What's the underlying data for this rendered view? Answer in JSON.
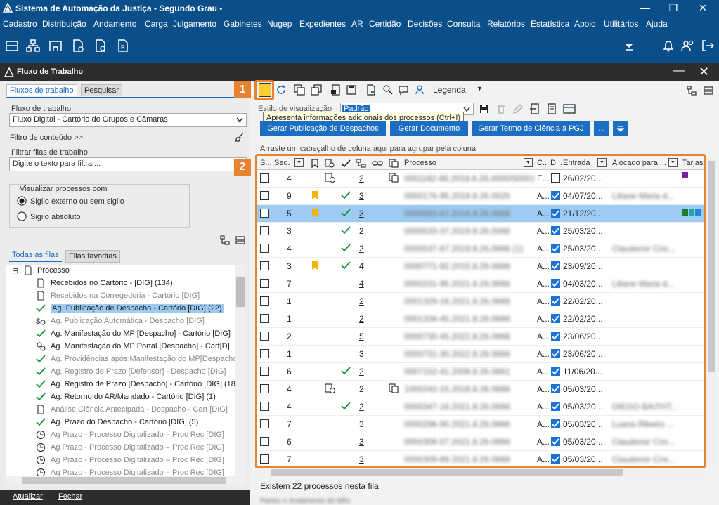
{
  "window": {
    "title": "Sistema de Automação da Justiça - Segundo Grau -"
  },
  "menu": [
    "Cadastro",
    "Distribuição",
    "Andamento",
    "Carga",
    "Julgamento",
    "Gabinetes",
    "Nugep",
    "Expedientes",
    "AR",
    "Certidão",
    "Decisões",
    "Consulta",
    "Relatórios",
    "Estatística",
    "Apoio",
    "Utilitários",
    "Ajuda"
  ],
  "panel": {
    "title": "Fluxo de Trabalho"
  },
  "left": {
    "tabs": [
      "Fluxos de trabalho",
      "Pesquisar"
    ],
    "fluxo_label": "Fluxo de trabalho",
    "fluxo_value": "Fluxo Digital - Cartório de Grupos e Câmaras",
    "filtro_conteudo": "Filtro de conteúdo >>",
    "filtrar_label": "Filtrar filas de trabalho",
    "filtrar_placeholder": "Digite o texto para filtrar...",
    "visualizar_label": "Visualizar processos com",
    "radio1": "Sigilo externo ou sem sigilo",
    "radio2": "Sigilo absoluto",
    "queue_tabs": [
      "Todas as filas",
      "Filas favoritas"
    ],
    "tree_root": "Processo",
    "tree": [
      {
        "label": "Recebidos no Cartório - [DIG] (134)",
        "icon": "document-icon",
        "gray": false
      },
      {
        "label": "Recebidos na Corregedoria - Cartório [DIG]",
        "icon": "document-icon",
        "gray": true
      },
      {
        "label": "Ag. Publicação de Despacho - Cartório [DIG] (22)",
        "icon": "check-icon",
        "gray": false,
        "selected": true
      },
      {
        "label": "Ag. Publicação Automática - Despacho [DIG]",
        "icon": "money-clock-icon",
        "gray": true
      },
      {
        "label": "Ag. Manifestação do MP [Despacho] - Cartório [DIG]",
        "icon": "check-icon",
        "gray": false
      },
      {
        "label": "Ag. Manifestação do MP Portal [Despacho] - Cart[D]",
        "icon": "gear-clock-icon",
        "gray": false
      },
      {
        "label": "Ag. Providências após Manifestação do MP[Despacho]",
        "icon": "check-icon",
        "gray": true
      },
      {
        "label": "Ag. Registro de Prazo [Defensor] - Despacho [DIG]",
        "icon": "check-icon",
        "gray": true
      },
      {
        "label": "Ag. Registro de Prazo [Despacho] - Cartório [DIG] (18",
        "icon": "check-icon",
        "gray": false
      },
      {
        "label": "Ag. Retorno do AR/Mandado - Cartório [DIG] (1)",
        "icon": "check-icon",
        "gray": false
      },
      {
        "label": "Análise Ciência Antecipada - Despacho - Cart [DIG]",
        "icon": "document-icon",
        "gray": true
      },
      {
        "label": "Ag. Prazo do Despacho - Cartório [DIG] (5)",
        "icon": "check-icon",
        "gray": false
      },
      {
        "label": "Ag Prazo - Processo Digitalizado – Proc Rec [DIG]",
        "icon": "clock-icon",
        "gray": true
      },
      {
        "label": "Ag Prazo - Processo Digitalizado – Proc Rec [DIG]",
        "icon": "clock-icon",
        "gray": true
      },
      {
        "label": "Ag Prazo - Processo Digitalizado – Proc Rec [DIG]",
        "icon": "clock-icon",
        "gray": true
      },
      {
        "label": "Ag Prazo - Processo Digitalizado – Proc Rec [DIG]",
        "icon": "clock-icon",
        "gray": true
      }
    ],
    "footer": {
      "atualizar": "Atualizar",
      "fechar": "Fechar"
    }
  },
  "right": {
    "legenda": "Legenda",
    "estilo_label": "Estilo de visualização",
    "estilo_value": "Padrão",
    "tooltip": "Apresenta informações adicionais dos processos (Ctrl+I)",
    "buttons": {
      "gerar_pub": "Gerar Publicação de Despachos",
      "gerar_doc": "Gerar Documento",
      "gerar_termo": "Gerar Termo de Ciência à PGJ",
      "more": "..."
    },
    "group_hint": "Arraste um cabeçalho de coluna aqui para agrupar pela coluna",
    "columns": {
      "s": "S...",
      "seq": "Seq.",
      "processo": "Processo",
      "c": "C...",
      "d": "D...",
      "entrada": "Entrada",
      "alocado": "Alocado para ...",
      "tarjas": "Tarjas"
    },
    "rows": [
      {
        "seq": "4",
        "flag": false,
        "check": false,
        "n": "2",
        "processo": "0001182-86.2019.8.26.0000/50001",
        "c": "E...",
        "d": false,
        "entrada": "26/02/20...",
        "alocado": "",
        "tarja": [
          "#7b1fa2"
        ],
        "icon1": true,
        "icon2": true
      },
      {
        "seq": "9",
        "flag": true,
        "check": true,
        "n": "3",
        "processo": "0000176-95.2019.8.26.0025",
        "c": "A...",
        "d": true,
        "entrada": "04/07/20...",
        "alocado": "Liliane Maria d...",
        "tarja": [],
        "icon1": false,
        "icon2": false
      },
      {
        "seq": "5",
        "flag": true,
        "check": true,
        "n": "3",
        "processo": "0000583-87.2016.8.26.0666",
        "c": "A...",
        "d": true,
        "entrada": "21/12/20...",
        "alocado": "",
        "tarja": [
          "#1e7d32",
          "#26a69a",
          "#1e88e5"
        ],
        "sel": true,
        "icon1": false,
        "icon2": false
      },
      {
        "seq": "3",
        "flag": false,
        "check": true,
        "n": "2",
        "processo": "0000533-37.2019.8.26.0066",
        "c": "A...",
        "d": true,
        "entrada": "25/03/20...",
        "alocado": "",
        "tarja": [],
        "icon1": false,
        "icon2": false
      },
      {
        "seq": "4",
        "flag": false,
        "check": true,
        "n": "2",
        "processo": "0000537-67.2019.8.26.0666 (1)",
        "c": "A...",
        "d": true,
        "entrada": "25/03/20...",
        "alocado": "Claudemir Cris...",
        "tarja": [],
        "icon1": false,
        "icon2": false
      },
      {
        "seq": "3",
        "flag": true,
        "check": true,
        "n": "4",
        "processo": "0000771-92.2015.8.26.0666",
        "c": "A...",
        "d": true,
        "entrada": "23/09/20...",
        "alocado": "",
        "tarja": [],
        "icon1": false,
        "icon2": false
      },
      {
        "seq": "7",
        "flag": false,
        "check": false,
        "n": "4",
        "processo": "0000231-95.2021.8.26.0666",
        "c": "A...",
        "d": true,
        "entrada": "04/03/20...",
        "alocado": "Liliane Maria d...",
        "tarja": [],
        "icon1": false,
        "icon2": false
      },
      {
        "seq": "1",
        "flag": false,
        "check": false,
        "n": "2",
        "processo": "0001329-16.2021.8.26.0666",
        "c": "A...",
        "d": true,
        "entrada": "22/02/20...",
        "alocado": "",
        "tarja": [],
        "icon1": false,
        "icon2": false
      },
      {
        "seq": "1",
        "flag": false,
        "check": false,
        "n": "2",
        "processo": "0001334-45.2021.8.26.0666",
        "c": "A...",
        "d": true,
        "entrada": "22/02/20...",
        "alocado": "",
        "tarja": [],
        "icon1": false,
        "icon2": false
      },
      {
        "seq": "2",
        "flag": false,
        "check": false,
        "n": "5",
        "processo": "0000730-45.2022.8.26.0666",
        "c": "A...",
        "d": true,
        "entrada": "23/06/20...",
        "alocado": "",
        "tarja": [],
        "icon1": false,
        "icon2": false
      },
      {
        "seq": "1",
        "flag": false,
        "check": false,
        "n": "3",
        "processo": "0000731-30.2022.8.26.0666",
        "c": "A...",
        "d": true,
        "entrada": "23/06/20...",
        "alocado": "",
        "tarja": [],
        "icon1": false,
        "icon2": false
      },
      {
        "seq": "6",
        "flag": false,
        "check": true,
        "n": "2",
        "processo": "0007152-41.2008.8.26.0661",
        "c": "A...",
        "d": true,
        "entrada": "11/06/20...",
        "alocado": "",
        "tarja": [],
        "icon1": false,
        "icon2": false
      },
      {
        "seq": "4",
        "flag": false,
        "check": false,
        "n": "2",
        "processo": "1000242-15.2018.8.26.0666",
        "c": "A...",
        "d": true,
        "entrada": "05/03/20...",
        "alocado": "",
        "tarja": [],
        "icon1": true,
        "icon2": true
      },
      {
        "seq": "4",
        "flag": false,
        "check": true,
        "n": "2",
        "processo": "0000347-16.2021.8.26.0666",
        "c": "A...",
        "d": true,
        "entrada": "05/03/20...",
        "alocado": "DIEGO BAITHT...",
        "tarja": [],
        "icon1": false,
        "icon2": false
      },
      {
        "seq": "7",
        "flag": false,
        "check": false,
        "n": "3",
        "processo": "0000296-90.2021.8.26.0666",
        "c": "A...",
        "d": true,
        "entrada": "05/03/20...",
        "alocado": "Luana Ribeiro ...",
        "tarja": [],
        "icon1": false,
        "icon2": false
      },
      {
        "seq": "6",
        "flag": false,
        "check": false,
        "n": "3",
        "processo": "0000308-07.2021.8.26.0666",
        "c": "A...",
        "d": true,
        "entrada": "05/03/20...",
        "alocado": "Claudemir Cris...",
        "tarja": [],
        "icon1": false,
        "icon2": false
      },
      {
        "seq": "7",
        "flag": false,
        "check": false,
        "n": "3",
        "processo": "0000309-89.2021.8.26.0666",
        "c": "A...",
        "d": true,
        "entrada": "05/03/20...",
        "alocado": "Claudemir Cris...",
        "tarja": [],
        "icon1": false,
        "icon2": false
      }
    ],
    "status": "Existem 22 processos nesta fila",
    "bottom_hint": "Partes  ∨  Andamento do Mês"
  },
  "callouts": [
    "1",
    "2"
  ],
  "colors": {
    "titlebar": "#0b4f8a",
    "accent": "#e8822f",
    "selection": "#9ecbf1",
    "button": "#1b6ec2"
  }
}
